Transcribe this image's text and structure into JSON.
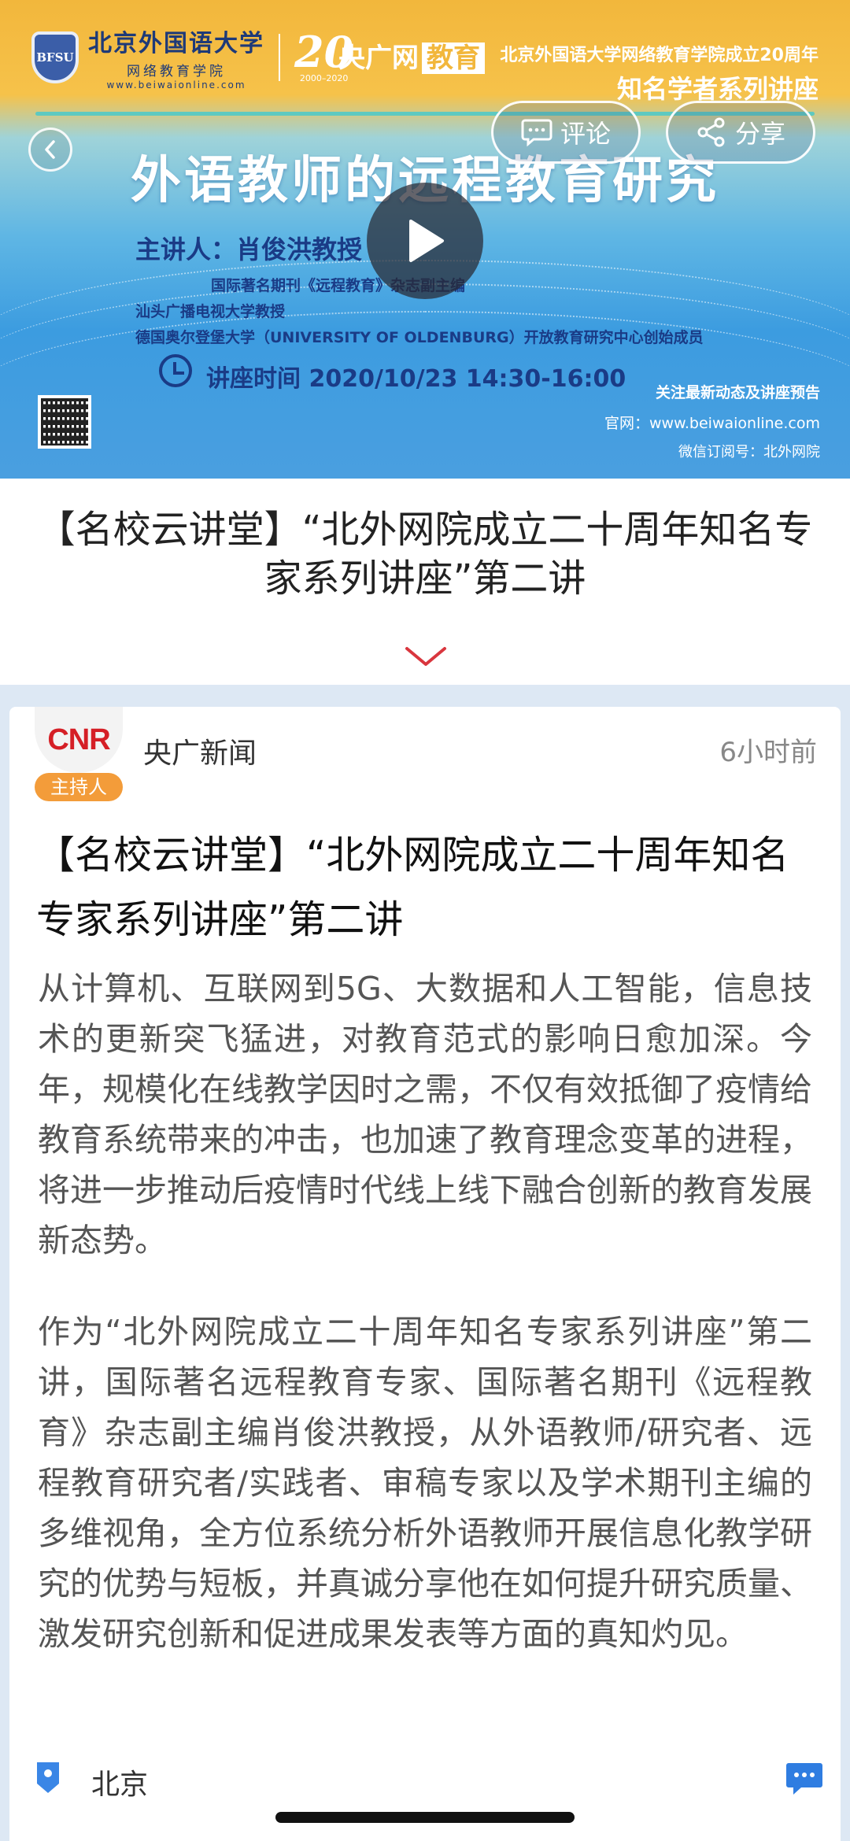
{
  "banner": {
    "school_name": "北京外国语大学",
    "school_sub": "网络教育学院",
    "school_url": "www.beiwaionline.com",
    "school_logo_text": "BFSU",
    "anniversary": "20",
    "anniversary_years": "2000–2020",
    "media_brand": "央广网",
    "media_tag": "教育",
    "series_line1": "北京外国语大学网络教育学院成立20周年",
    "series_line2": "知名学者系列讲座",
    "lecture_title": "外语教师的远程教育研究",
    "speaker_name": "主讲人：肖俊洪教授",
    "speaker_titles": [
      "国际著名期刊《远程教育》杂志副主编",
      "汕头广播电视大学教授",
      "德国奥尔登堡大学（UNIVERSITY OF OLDENBURG）开放教育研究中心创始成员"
    ],
    "lecture_time": "讲座时间  2020/10/23 14:30-16:00",
    "note1": "关注最新动态及讲座预告",
    "note2": "官网：www.beiwaionline.com",
    "note3": "微信订阅号：北外网院",
    "comment_label": "评论",
    "share_label": "分享"
  },
  "header": {
    "title": "【名校云讲堂】“北外网院成立二十周年知名专家系列讲座”第二讲"
  },
  "article": {
    "avatar_text": "CNR",
    "host_badge": "主持人",
    "source": "央广新闻",
    "time": "6小时前",
    "title": "【名校云讲堂】“北外网院成立二十周年知名专家系列讲座”第二讲",
    "paragraph1": "从计算机、互联网到5G、大数据和人工智能，信息技术的更新突飞猛进，对教育范式的影响日愈加深。今年，规模化在线教学因时之需，不仅有效抵御了疫情给教育系统带来的冲击，也加速了教育理念变革的进程，将进一步推动后疫情时代线上线下融合创新的教育发展新态势。",
    "paragraph2": "作为“北外网院成立二十周年知名专家系列讲座”第二讲，国际著名远程教育专家、国际著名期刊《远程教育》杂志副主编肖俊洪教授，从外语教师/研究者、远程教育研究者/实践者、审稿专家以及学术期刊主编的多维视角，全方位系统分析外语教师开展信息化教学研究的优势与短板，并真诚分享他在如何提升研究质量、激发研究创新和促进成果发表等方面的真知灼见。",
    "location": "北京"
  },
  "colors": {
    "accent_red": "#d9363e",
    "badge_orange": "#f39c3a",
    "chat_blue": "#2f7de1",
    "location_blue": "#3a86e6"
  }
}
